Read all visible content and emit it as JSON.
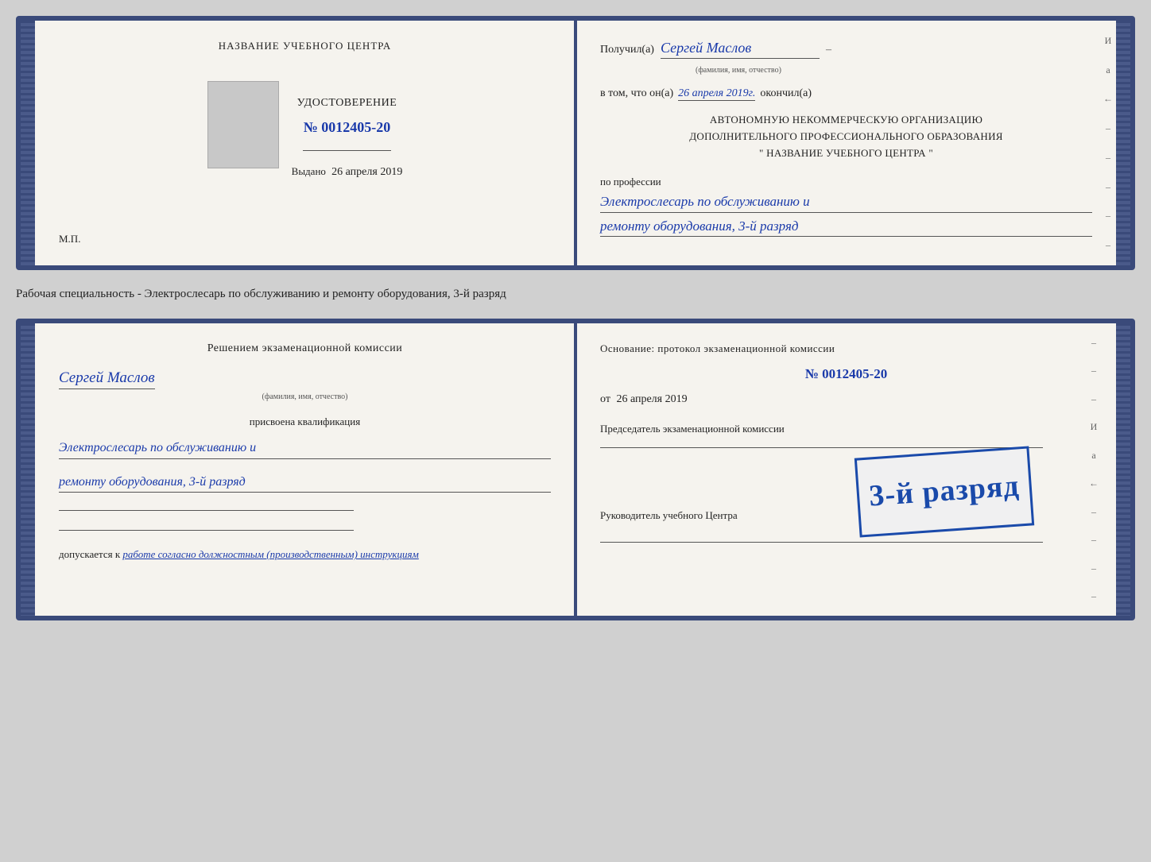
{
  "card1": {
    "left": {
      "title": "НАЗВАНИЕ УЧЕБНОГО ЦЕНТРА",
      "photo_alt": "photo",
      "cert_label": "УДОСТОВЕРЕНИЕ",
      "cert_number": "№ 0012405-20",
      "issued_prefix": "Выдано",
      "issued_date": "26 апреля 2019",
      "mp_label": "М.П."
    },
    "right": {
      "poluchil": "Получил(а)",
      "recipient_name": "Сергей Маслов",
      "fio_label": "(фамилия, имя, отчество)",
      "dash": "–",
      "vtom": "в том, что он(а)",
      "date_value": "26 апреля 2019г.",
      "okonchil": "окончил(а)",
      "org_line1": "АВТОНОМНУЮ НЕКОММЕРЧЕСКУЮ ОРГАНИЗАЦИЮ",
      "org_line2": "ДОПОЛНИТЕЛЬНОГО ПРОФЕССИОНАЛЬНОГО ОБРАЗОВАНИЯ",
      "org_line3": "\"    НАЗВАНИЕ УЧЕБНОГО ЦЕНТРА    \"",
      "po_professii": "по профессии",
      "profession_line1": "Электрослесарь по обслуживанию и",
      "profession_line2": "ремонту оборудования, 3-й разряд"
    }
  },
  "specialty_line": "Рабочая специальность - Электрослесарь по обслуживанию и ремонту оборудования, 3-й разряд",
  "card2": {
    "left": {
      "resheniem": "Решением экзаменационной комиссии",
      "name": "Сергей Маслов",
      "fio_label": "(фамилия, имя, отчество)",
      "prisvoena": "присвоена квалификация",
      "kvalif_line1": "Электрослесарь по обслуживанию и",
      "kvalif_line2": "ремонту оборудования, 3-й разряд",
      "dopuskaetsya": "допускается к",
      "dopusk_text": "работе согласно должностным (производственным) инструкциям"
    },
    "right": {
      "osnov": "Основание: протокол экзаменационной комиссии",
      "proto_number": "№ 0012405-20",
      "ot_prefix": "от",
      "ot_date": "26 апреля 2019",
      "chairman": "Председатель экзаменационной комиссии",
      "stamp_text": "3-й разряд",
      "rukov": "Руководитель учебного Центра"
    }
  }
}
